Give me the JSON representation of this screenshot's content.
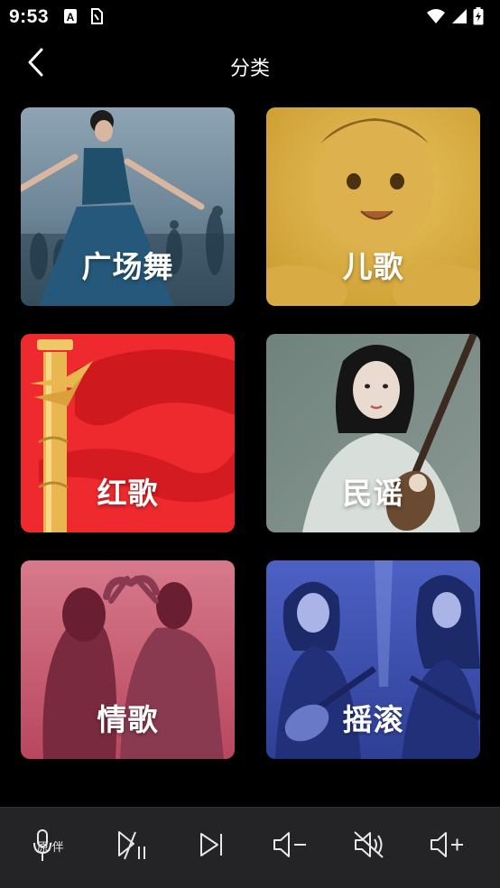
{
  "status_bar": {
    "time": "9:53",
    "icons": [
      "a-notification-icon",
      "sim-card-icon",
      "wifi-icon",
      "signal-icon",
      "battery-charging-icon"
    ]
  },
  "header": {
    "title": "分类",
    "back_icon": "chevron-left-icon"
  },
  "categories": [
    {
      "label": "广场舞",
      "theme": "#5b7a8c"
    },
    {
      "label": "儿歌",
      "theme": "#d8a93a"
    },
    {
      "label": "红歌",
      "theme": "#e8262c"
    },
    {
      "label": "民谣",
      "theme": "#7a8c86"
    },
    {
      "label": "情歌",
      "theme": "#c4506a"
    },
    {
      "label": "摇滚",
      "theme": "#3c4fa8"
    }
  ],
  "player": {
    "vocal_toggle_label": "原/伴",
    "icons": [
      "vocal-toggle-icon",
      "play-pause-icon",
      "next-track-icon",
      "volume-down-icon",
      "mute-icon",
      "volume-up-icon"
    ]
  },
  "colors": {
    "background": "#000000",
    "player_bar": "#242426",
    "icon": "#e8e8e8"
  }
}
